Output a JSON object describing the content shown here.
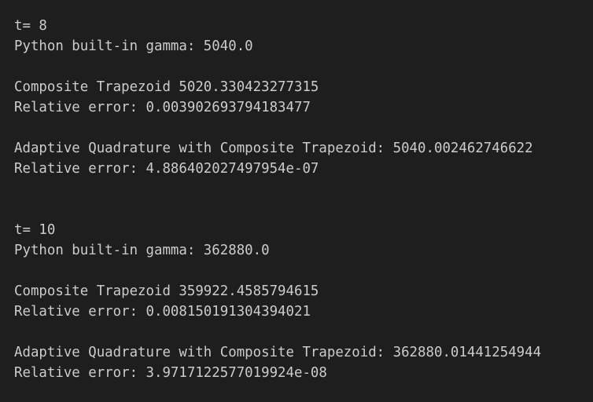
{
  "output": {
    "blocks": [
      {
        "t_line": "t= 8",
        "builtin_line": "Python built-in gamma: 5040.0",
        "trap_line": "Composite Trapezoid 5020.330423277315",
        "trap_error_line": "Relative error: 0.003902693794183477",
        "adaptive_line": "Adaptive Quadrature with Composite Trapezoid: 5040.002462746622",
        "adaptive_error_line": "Relative error: 4.886402027497954e-07"
      },
      {
        "t_line": "t= 10",
        "builtin_line": "Python built-in gamma: 362880.0",
        "trap_line": "Composite Trapezoid 359922.4585794615",
        "trap_error_line": "Relative error: 0.008150191304394021",
        "adaptive_line": "Adaptive Quadrature with Composite Trapezoid: 362880.01441254944",
        "adaptive_error_line": "Relative error: 3.9717122577019924e-08"
      }
    ]
  }
}
